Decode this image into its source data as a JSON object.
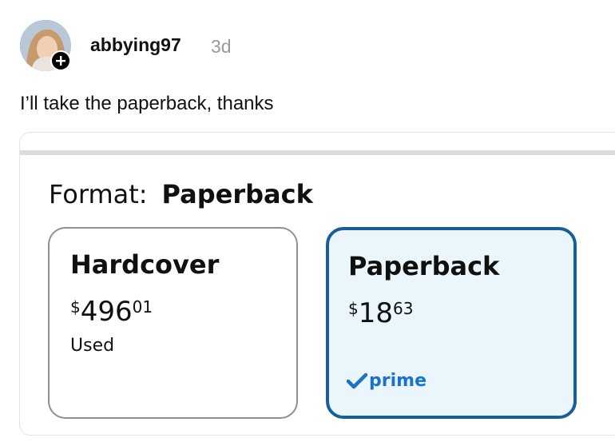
{
  "post": {
    "username": "abbying97",
    "timestamp": "3d",
    "comment": "I’ll take the paperback, thanks"
  },
  "screenshot": {
    "format_label": "Format:",
    "format_value": "Paperback",
    "options": [
      {
        "title": "Hardcover",
        "price_currency": "$",
        "price_whole": "496",
        "price_fraction": "01",
        "condition": "Used",
        "selected": false
      },
      {
        "title": "Paperback",
        "price_currency": "$",
        "price_whole": "18",
        "price_fraction": "63",
        "badge": "prime",
        "selected": true
      }
    ]
  },
  "colors": {
    "selected_border": "#1a5e97",
    "selected_background": "#eaf6fc",
    "prime_blue": "#1a73c8",
    "timestamp_gray": "#9a9a9a"
  },
  "icons": [
    "avatar",
    "add-follow-icon",
    "prime-check-icon"
  ]
}
